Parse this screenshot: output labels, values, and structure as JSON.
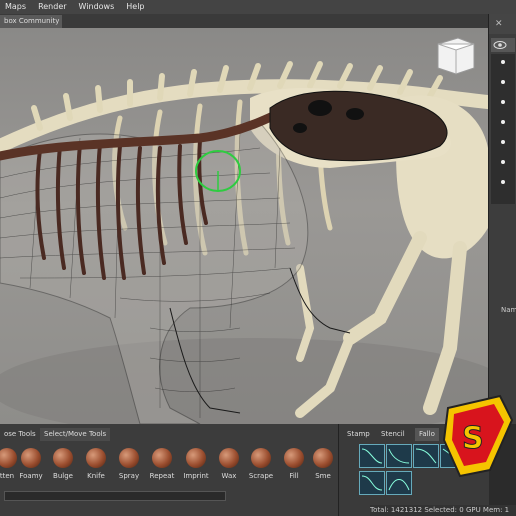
{
  "menubar": {
    "items": [
      "Maps",
      "Render",
      "Windows",
      "Help"
    ]
  },
  "doc_tab": {
    "label": "box Community"
  },
  "shelf": {
    "tabs": [
      "ose Tools",
      "Select/Move Tools"
    ],
    "tools": [
      "tten",
      "Foamy",
      "Bulge",
      "Knife",
      "Spray",
      "Repeat",
      "Imprint",
      "Wax",
      "Scrape",
      "Fill",
      "Sme"
    ]
  },
  "stamp_panel": {
    "tabs": [
      "Stamp",
      "Stencil",
      "Fallo"
    ]
  },
  "right_panel": {
    "name_label": "Nam"
  },
  "status": {
    "text": "Total: 1421312  Selected: 0  GPU Mem: 1"
  },
  "colors": {
    "menubar": "#444444",
    "viewport_bg": "#8e8d8a",
    "bone": "#e4dcc0",
    "mesh": "#1a1a1a",
    "sculpt_ring": "#2ecc40",
    "logo_red": "#d8141d",
    "logo_yellow": "#f5c400"
  },
  "icons": [
    "view-cube-icon",
    "eye-icon",
    "close-icon",
    "sculpt-brush-icon"
  ]
}
